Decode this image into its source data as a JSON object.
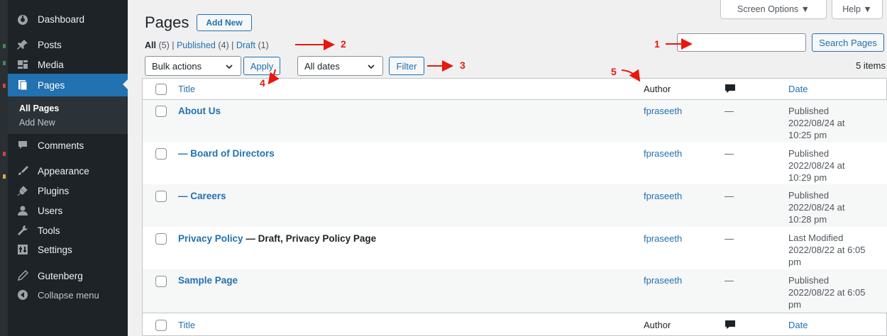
{
  "colors": {
    "accent": "#2271b1",
    "sidebar": "#1d2327",
    "annotation": "#e8180b"
  },
  "sidebar": {
    "items": [
      {
        "label": "Dashboard",
        "icon": "dashboard-icon"
      },
      {
        "label": "Posts",
        "icon": "pin-icon"
      },
      {
        "label": "Media",
        "icon": "media-icon"
      },
      {
        "label": "Pages",
        "icon": "pages-icon",
        "active": true
      },
      {
        "label": "Comments",
        "icon": "comment-icon"
      },
      {
        "label": "Appearance",
        "icon": "brush-icon"
      },
      {
        "label": "Plugins",
        "icon": "plugin-icon"
      },
      {
        "label": "Users",
        "icon": "users-icon"
      },
      {
        "label": "Tools",
        "icon": "wrench-icon"
      },
      {
        "label": "Settings",
        "icon": "settings-icon"
      },
      {
        "label": "Gutenberg",
        "icon": "pencil-icon"
      }
    ],
    "submenu": [
      "All Pages",
      "Add New"
    ],
    "collapse": "Collapse menu"
  },
  "header": {
    "title": "Pages",
    "add_new": "Add New",
    "screen_options": "Screen Options ▼",
    "help": "Help ▼"
  },
  "filters": {
    "all": "All",
    "all_count": "(5)",
    "sep": "|",
    "published": "Published",
    "published_count": "(4)",
    "draft": "Draft",
    "draft_count": "(1)"
  },
  "search": {
    "value": "",
    "button": "Search Pages"
  },
  "toolbar": {
    "bulk": "Bulk actions",
    "apply": "Apply",
    "dates": "All dates",
    "filter": "Filter",
    "items_count": "5 items"
  },
  "table": {
    "columns": {
      "title": "Title",
      "author": "Author",
      "date": "Date"
    },
    "rows": [
      {
        "title": "About Us",
        "suffix": "",
        "author": "fpraseeth",
        "comments": "—",
        "date": [
          "Published",
          "2022/08/24 at",
          "10:25 pm"
        ]
      },
      {
        "title": "— Board of Directors",
        "suffix": "",
        "author": "fpraseeth",
        "comments": "—",
        "date": [
          "Published",
          "2022/08/24 at",
          "10:29 pm"
        ]
      },
      {
        "title": "— Careers",
        "suffix": "",
        "author": "fpraseeth",
        "comments": "—",
        "date": [
          "Published",
          "2022/08/24 at",
          "10:28 pm"
        ]
      },
      {
        "title": "Privacy Policy",
        "suffix": " — Draft, Privacy Policy Page",
        "author": "fpraseeth",
        "comments": "—",
        "date": [
          "Last Modified",
          "2022/08/22 at 6:05",
          "pm"
        ]
      },
      {
        "title": "Sample Page",
        "suffix": "",
        "author": "fpraseeth",
        "comments": "—",
        "date": [
          "Published",
          "2022/08/22 at 6:05",
          "pm"
        ]
      }
    ]
  },
  "annotations": [
    "1",
    "2",
    "3",
    "4",
    "5"
  ]
}
